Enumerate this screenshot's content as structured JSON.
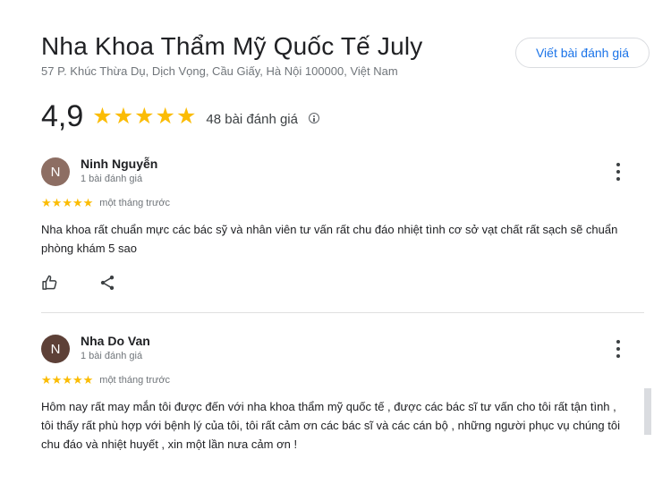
{
  "place": {
    "title": "Nha Khoa Thẩm Mỹ Quốc Tế July",
    "address": "57 P. Khúc Thừa Dụ, Dịch Vọng, Cầu Giấy, Hà Nội 100000, Việt Nam",
    "write_review_label": "Viết bài đánh giá"
  },
  "rating": {
    "value": "4,9",
    "stars": 5,
    "count_label": "48 bài đánh giá",
    "info_icon": "info-icon"
  },
  "reviews": [
    {
      "initial": "N",
      "avatar_color": "#8d6e63",
      "name": "Ninh Nguyễn",
      "meta": "1 bài đánh giá",
      "stars": 5,
      "time": "một tháng trước",
      "text": "Nha khoa rất chuẩn mực các bác sỹ và nhân viên tư vấn rất chu đáo nhiệt tình cơ sở vạt chất rất sạch sẽ chuẩn phòng khám 5 sao"
    },
    {
      "initial": "N",
      "avatar_color": "#5d4037",
      "name": "Nha Do Van",
      "meta": "1 bài đánh giá",
      "stars": 5,
      "time": "một tháng trước",
      "text": "Hôm nay rất may mắn tôi được đến với nha khoa thẩm mỹ quốc tế , được các bác sĩ tư vấn cho tôi rất tận tình , tôi thấy rất phù hợp với bệnh lý của tôi, tôi rất cảm ơn các bác sĩ và các cán bộ , những người phục vụ chúng tôi chu đáo và nhiệt huyết , xin một lần nưa cảm ơn !"
    }
  ],
  "colors": {
    "accent": "#1a73e8",
    "star": "#fbbc04"
  },
  "icons": {
    "more": "more-vert-icon",
    "like": "thumbs-up-icon",
    "share": "share-icon"
  }
}
